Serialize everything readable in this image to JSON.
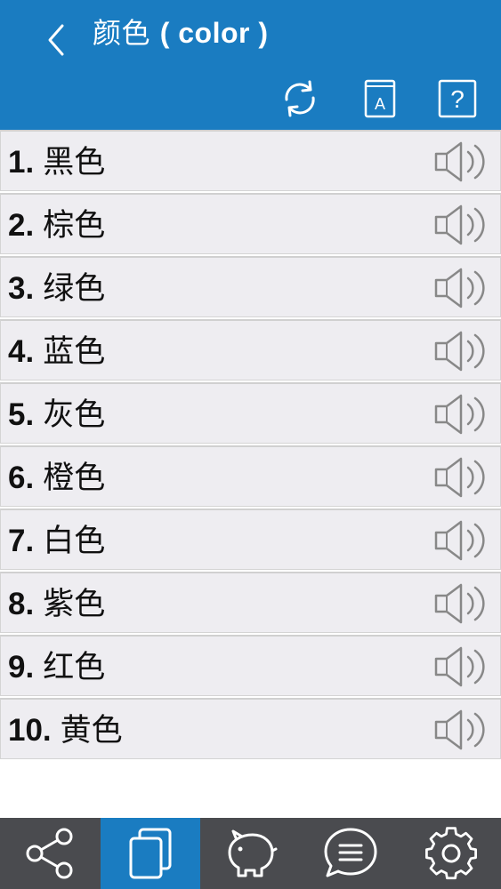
{
  "header": {
    "title_cn": "颜色",
    "title_en": "( color )",
    "back_icon": "chevron-left-icon"
  },
  "toolbar": [
    {
      "icon": "refresh-icon"
    },
    {
      "icon": "dictionary-icon",
      "letter": "A"
    },
    {
      "icon": "help-icon",
      "letter": "?"
    }
  ],
  "items": [
    {
      "num": "1.",
      "word": "黑色"
    },
    {
      "num": "2.",
      "word": "棕色"
    },
    {
      "num": "3.",
      "word": "绿色"
    },
    {
      "num": "4.",
      "word": "蓝色"
    },
    {
      "num": "5.",
      "word": "灰色"
    },
    {
      "num": "6.",
      "word": "橙色"
    },
    {
      "num": "7.",
      "word": "白色"
    },
    {
      "num": "8.",
      "word": "紫色"
    },
    {
      "num": "9.",
      "word": "红色"
    },
    {
      "num": "10.",
      "word": "黄色"
    }
  ],
  "nav": [
    {
      "icon": "share-icon",
      "active": false
    },
    {
      "icon": "flashcards-icon",
      "active": true
    },
    {
      "icon": "piggy-bank-icon",
      "active": false
    },
    {
      "icon": "chat-icon",
      "active": false
    },
    {
      "icon": "settings-gear-icon",
      "active": false
    }
  ],
  "colors": {
    "header": "#1a7cc1",
    "row_bg": "#eeedf1",
    "nav_bg": "#4a4b4f",
    "nav_active": "#1a7cc1",
    "icon_gray": "#888888"
  }
}
